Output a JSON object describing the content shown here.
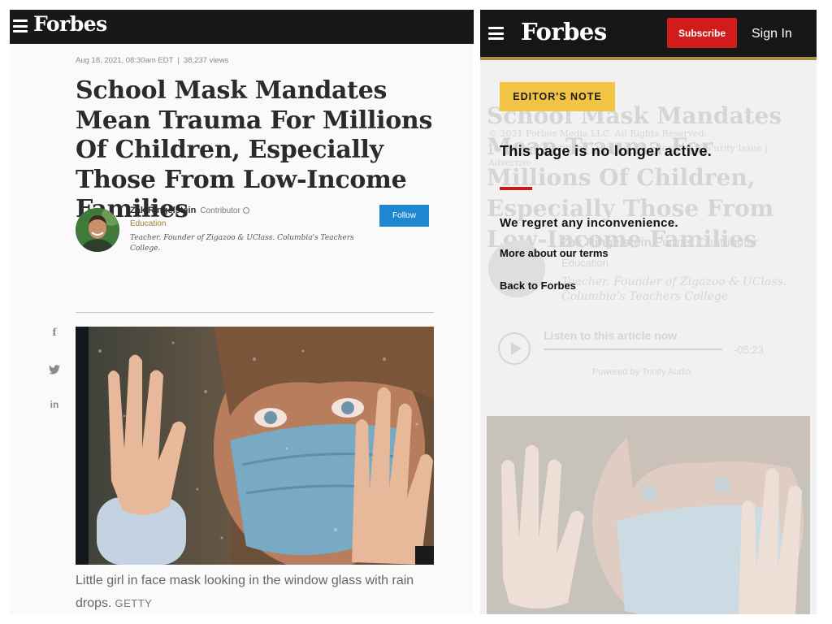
{
  "left_article": {
    "logo": "Forbes",
    "meta": {
      "date": "Aug 18, 2021, 08:30am EDT",
      "separator": "|",
      "views": "38,237 views"
    },
    "headline": "School Mask Mandates Mean Trauma For Millions Of Children, Especially Those From Low-Income Families",
    "author": {
      "name": "Zak Ringelstein",
      "role": "Contributor",
      "section": "Education",
      "bio": "Teacher. Founder of Zigazoo & UClass. Columbia's Teachers College."
    },
    "follow_label": "Follow",
    "share": {
      "facebook": "f",
      "twitter_icon": "twitter-bird",
      "linkedin": "in"
    },
    "caption": "Little girl in face mask looking in the window glass with rain drops.",
    "credit": "GETTY"
  },
  "right_page": {
    "logo": "Forbes",
    "subscribe_label": "Subscribe",
    "signin_label": "Sign In",
    "editors_note": "EDITOR'S NOTE",
    "message_title": "This page is no longer active.",
    "regret": "We regret any inconvenience.",
    "terms_link": "More about our terms",
    "back_link": "Back to Forbes",
    "ghost": {
      "headline": "School Mask Mandates Mean Trauma For Millions Of Children, Especially Those From Low-Income Families",
      "copyright": "© 2021 Forbes Media LLC. All Rights Reserved.",
      "footer_links": "Terms and Conditions | Contact Us | Report a Security Issue | Advertise",
      "author_name": "Zak Ringelstein",
      "author_role": "Former Contributor",
      "section": "Education",
      "bio": "Teacher. Founder of Zigazoo & UClass. Columbia's Teachers College.",
      "listen": "Listen to this article now",
      "time": "-05:23",
      "powered_by": "Powered by Trinity Audio"
    }
  },
  "colors": {
    "header_bg": "#181818",
    "follow_blue": "#1f86d0",
    "subscribe_red": "#d21b1b",
    "editors_note_yellow": "#f3c343",
    "gold_rule": "#a98e4a",
    "section_gold": "#a0822f"
  }
}
